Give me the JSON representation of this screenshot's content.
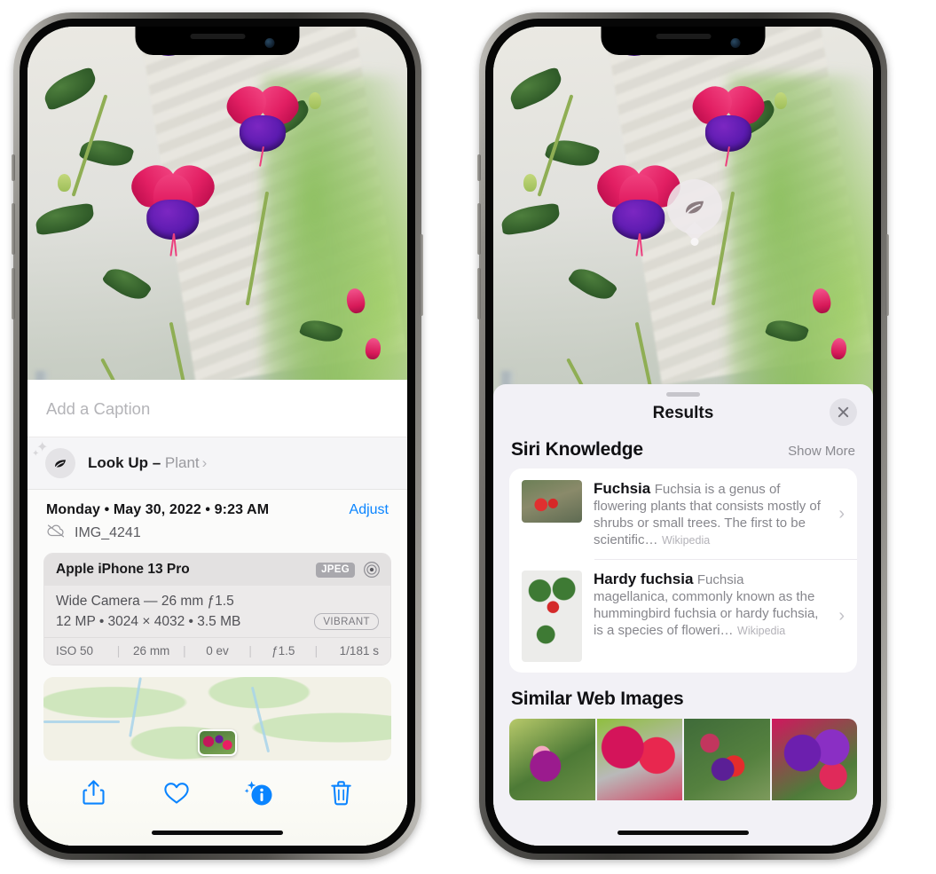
{
  "left_phone": {
    "caption_placeholder": "Add a Caption",
    "lookup": {
      "label": "Look Up –",
      "subject": "Plant",
      "chevron": "›",
      "icon": "leaf-icon"
    },
    "date_line": "Monday • May 30, 2022 • 9:23 AM",
    "adjust_label": "Adjust",
    "file_name": "IMG_4241",
    "cloud_icon": "cloud-slash-icon",
    "exif": {
      "device": "Apple iPhone 13 Pro",
      "format_tag": "JPEG",
      "raw_icon": "raw-target-icon",
      "lens_line": "Wide Camera — 26 mm ƒ1.5",
      "size_line": "12 MP • 3024 × 4032 • 3.5 MB",
      "style_tag": "VIBRANT",
      "stats": [
        "ISO 50",
        "26 mm",
        "0 ev",
        "ƒ1.5",
        "1/181 s"
      ]
    },
    "toolbar": [
      {
        "name": "share-button",
        "icon": "share-icon"
      },
      {
        "name": "favorite-button",
        "icon": "heart-icon"
      },
      {
        "name": "info-button",
        "icon": "info-sparkle-icon"
      },
      {
        "name": "delete-button",
        "icon": "trash-icon"
      }
    ]
  },
  "right_phone": {
    "bubble_icon": "leaf-icon",
    "sheet_title": "Results",
    "close_icon": "close-icon",
    "siri_section": {
      "title": "Siri Knowledge",
      "show_more": "Show More"
    },
    "cards": [
      {
        "title": "Fuchsia",
        "description": "Fuchsia is a genus of flowering plants that consists mostly of shrubs or small trees. The first to be scientific…",
        "source": "Wikipedia",
        "chevron": "›"
      },
      {
        "title": "Hardy fuchsia",
        "description": "Fuchsia magellanica, commonly known as the hummingbird fuchsia or hardy fuchsia, is a species of floweri…",
        "source": "Wikipedia",
        "chevron": "›"
      }
    ],
    "similar_section": {
      "title": "Similar Web Images"
    },
    "similar_images": [
      {
        "name": "similar-image-1"
      },
      {
        "name": "similar-image-2"
      },
      {
        "name": "similar-image-3"
      },
      {
        "name": "similar-image-4"
      }
    ]
  },
  "colors": {
    "accent_blue": "#0a84ff",
    "sheet_bg": "#f2f1f6",
    "card_bg": "#ffffff",
    "secondary_text": "#86868c"
  }
}
